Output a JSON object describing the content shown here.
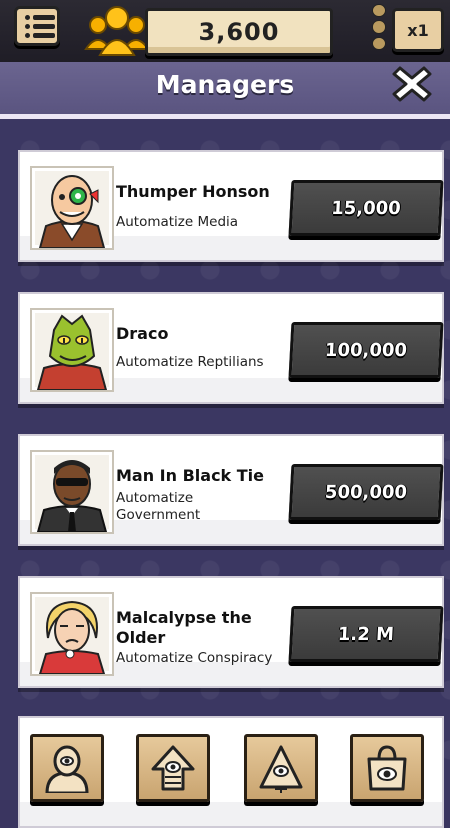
{
  "top_bar": {
    "menu_icon": "list-icon",
    "currency_icon": "followers-icon",
    "currency_value": "3,600",
    "more_icon": "vertical-dots-icon",
    "multiplier_label": "x1"
  },
  "header": {
    "title": "Managers",
    "close_icon": "close-x-icon"
  },
  "managers": [
    {
      "name": "Thumper Honson",
      "task": "Automatize Media",
      "price": "15,000"
    },
    {
      "name": "Draco",
      "task": "Automatize Reptilians",
      "price": "100,000"
    },
    {
      "name": "Man In Black Tie",
      "task": "Automatize Government",
      "price": "500,000"
    },
    {
      "name": "Malcalypse the Older",
      "task": "Automatize Conspiracy",
      "price": "1.2 M"
    }
  ],
  "bottom_nav": {
    "items": [
      "manager-eye-icon",
      "upgrade-arrow-eye-icon",
      "pyramid-eye-icon",
      "shop-bag-eye-icon"
    ]
  },
  "colors": {
    "background": "#3b3762",
    "header": "#6b6590",
    "button_dark": "#444444",
    "button_tan": "#e8cfa3"
  }
}
